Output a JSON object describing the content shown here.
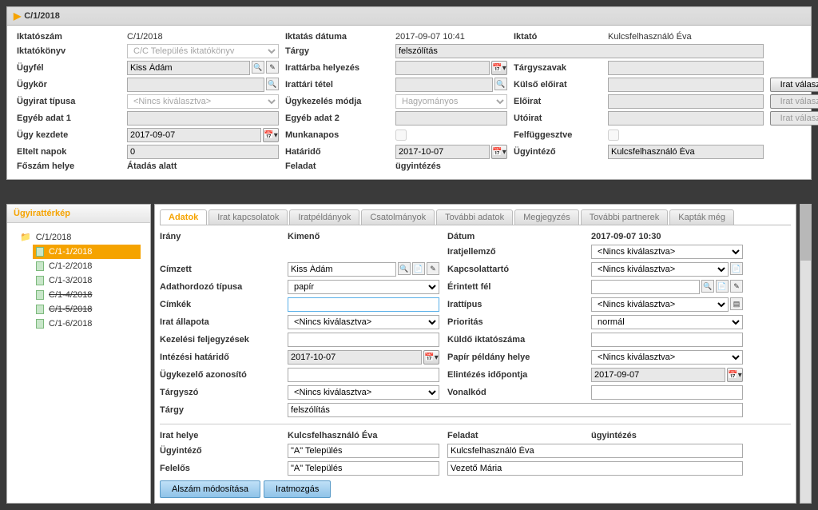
{
  "title": "C/1/2018",
  "top": {
    "iktatoszam_lbl": "Iktatószám",
    "iktatoszam": "C/1/2018",
    "iktatodatum_lbl": "Iktatás dátuma",
    "iktatodatum": "2017-09-07 10:41",
    "iktato_lbl": "Iktató",
    "iktato": "Kulcsfelhasználó Éva",
    "iktatokonyv_lbl": "Iktatókönyv",
    "iktatokonyv": "C/C Település iktatókönyv",
    "targy_lbl": "Tárgy",
    "targy": "felszólítás",
    "ugyfel_lbl": "Ügyfél",
    "ugyfel": "Kiss Ádám",
    "irattarba_lbl": "Irattárba helyezés",
    "irattarba": "",
    "targyszavak_lbl": "Tárgyszavak",
    "ugykor_lbl": "Ügykör",
    "irattaritetel_lbl": "Irattári tétel",
    "kulsoeloirat_lbl": "Külső előirat",
    "iratvalasztas_btn": "Irat választás",
    "ugyirattipusa_lbl": "Ügyirat típusa",
    "ugyirattipusa": "<Nincs kiválasztva>",
    "ugykezelesmodja_lbl": "Ügykezelés módja",
    "ugykezelesmodja": "Hagyományos",
    "eloirat_lbl": "Előirat",
    "egyeb1_lbl": "Egyéb adat 1",
    "egyeb2_lbl": "Egyéb adat 2",
    "utoirat_lbl": "Utóirat",
    "ugykezdete_lbl": "Ügy kezdete",
    "ugykezdete": "2017-09-07",
    "munkanapos_lbl": "Munkanapos",
    "felfuggesztve_lbl": "Felfüggesztve",
    "elteltnapok_lbl": "Eltelt napok",
    "elteltnapok": "0",
    "hatarido_lbl": "Határidő",
    "hatarido": "2017-10-07",
    "ugyintezo_lbl": "Ügyintéző",
    "ugyintezo": "Kulcsfelhasználó Éva",
    "foszamhelye_lbl": "Főszám helye",
    "foszamhelye": "Átadás alatt",
    "feladat_lbl": "Feladat",
    "feladat": "ügyintézés"
  },
  "sidebar": {
    "title": "Ügyirattérkép",
    "root": "C/1/2018",
    "items": [
      {
        "label": "C/1-1/2018",
        "active": true
      },
      {
        "label": "C/1-2/2018"
      },
      {
        "label": "C/1-3/2018"
      },
      {
        "label": "C/1-4/2018",
        "struck": true
      },
      {
        "label": "C/1-5/2018",
        "struck": true
      },
      {
        "label": "C/1-6/2018"
      }
    ]
  },
  "tabs": [
    "Adatok",
    "Irat kapcsolatok",
    "Iratpéldányok",
    "Csatolmányok",
    "További adatok",
    "Megjegyzés",
    "További partnerek",
    "Kapták még"
  ],
  "form": {
    "irany_lbl": "Irány",
    "irany": "Kimenő",
    "datum_lbl": "Dátum",
    "datum": "2017-09-07 10:30",
    "iratjellemzo_lbl": "Iratjellemző",
    "iratjellemzo": "<Nincs kiválasztva>",
    "cimzett_lbl": "Címzett",
    "cimzett": "Kiss Ádám",
    "kapcsolattarto_lbl": "Kapcsolattartó",
    "kapcsolattarto": "<Nincs kiválasztva>",
    "adathordozo_lbl": "Adathordozó típusa",
    "adathordozo": "papír",
    "erintettfel_lbl": "Érintett fél",
    "cimkek_lbl": "Címkék",
    "irattipus_lbl": "Irattípus",
    "irattipus": "<Nincs kiválasztva>",
    "iratallapota_lbl": "Irat állapota",
    "iratallapota": "<Nincs kiválasztva>",
    "prioritas_lbl": "Prioritás",
    "prioritas": "normál",
    "kezelesi_lbl": "Kezelési feljegyzések",
    "kuldoiktato_lbl": "Küldő iktatószáma",
    "intezesi_lbl": "Intézési határidő",
    "intezesi": "2017-10-07",
    "papirpeldany_lbl": "Papír példány helye",
    "papirpeldany": "<Nincs kiválasztva>",
    "ugykezelo_lbl": "Ügykezelő azonosító",
    "elintezes_lbl": "Elintézés időpontja",
    "elintezes": "2017-09-07",
    "targyszo_lbl": "Tárgyszó",
    "targyszo": "<Nincs kiválasztva>",
    "vonalkod_lbl": "Vonalkód",
    "targy_lbl": "Tárgy",
    "targy": "felszólítás",
    "irathelye_lbl": "Irat helye",
    "irathelye": "Kulcsfelhasználó Éva",
    "feladat_lbl": "Feladat",
    "feladat": "ügyintézés",
    "ugyintezo_lbl": "Ügyintéző",
    "ugyintezo_val": "\"A\" Település",
    "ugyintezo_r": "Kulcsfelhasználó Éva",
    "felelos_lbl": "Felelős",
    "felelos_val": "\"A\" Település",
    "felelos_r": "Vezető Mária"
  },
  "actions": {
    "alszam": "Alszám módosítása",
    "iratmozgas": "Iratmozgás"
  }
}
